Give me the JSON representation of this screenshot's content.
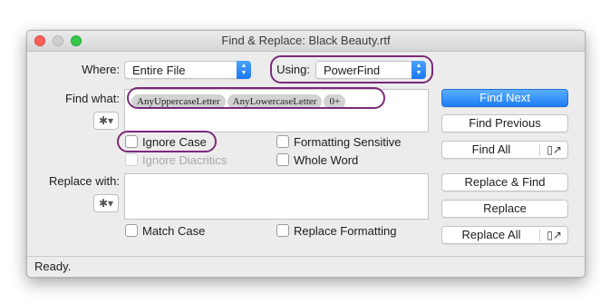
{
  "window": {
    "title": "Find & Replace: Black Beauty.rtf"
  },
  "where": {
    "label": "Where:",
    "value": "Entire File"
  },
  "using": {
    "label": "Using:",
    "value": "PowerFind"
  },
  "find": {
    "label": "Find what:",
    "tokens": [
      "AnyUppercaseLetter",
      "AnyLowercaseLetter",
      "0+"
    ]
  },
  "replace": {
    "label": "Replace with:"
  },
  "options": {
    "ignore_case": "Ignore Case",
    "ignore_diacritics": "Ignore Diacritics",
    "formatting_sensitive": "Formatting Sensitive",
    "whole_word": "Whole Word",
    "match_case": "Match Case",
    "replace_formatting": "Replace Formatting"
  },
  "buttons": {
    "find_next": "Find Next",
    "find_previous": "Find Previous",
    "find_all": "Find All",
    "replace_and_find": "Replace & Find",
    "replace": "Replace",
    "replace_all": "Replace All"
  },
  "status": {
    "text": "Ready."
  },
  "colors": {
    "accent": "#1f7df4",
    "highlight_ring": "#7a2a7a"
  }
}
